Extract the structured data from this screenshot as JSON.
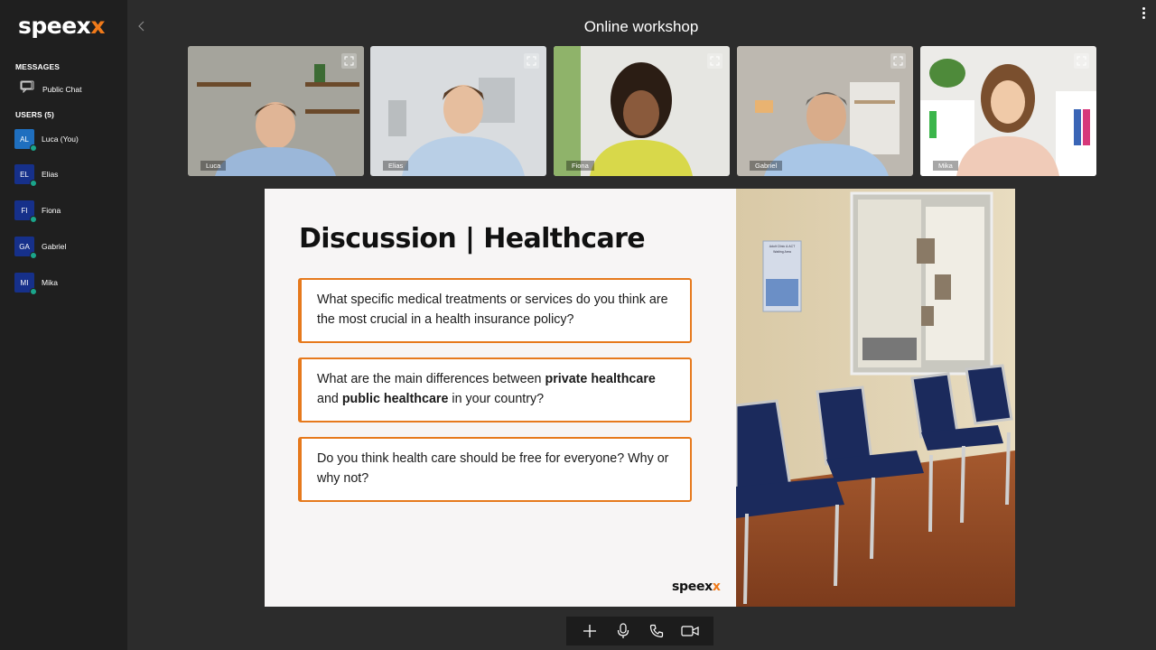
{
  "app": {
    "logo_main": "speex",
    "logo_accent": "x",
    "title": "Online workshop"
  },
  "sidebar": {
    "messages_heading": "MESSAGES",
    "public_chat_label": "Public Chat",
    "users_heading": "USERS (5)",
    "users": [
      {
        "initials": "AL",
        "name": "Luca (You)",
        "color": "#1f6fbf"
      },
      {
        "initials": "EL",
        "name": "Elias",
        "color": "#16308a"
      },
      {
        "initials": "FI",
        "name": "Fiona",
        "color": "#16308a"
      },
      {
        "initials": "GA",
        "name": "Gabriel",
        "color": "#16308a"
      },
      {
        "initials": "MI",
        "name": "Mika",
        "color": "#16308a"
      }
    ],
    "status_color": "#1aa58b"
  },
  "videos": [
    {
      "name": "Luca"
    },
    {
      "name": "Elias"
    },
    {
      "name": "Fiona"
    },
    {
      "name": "Gabriel"
    },
    {
      "name": "Mika"
    }
  ],
  "slide": {
    "title": "Discussion | Healthcare",
    "q1": "What specific medical treatments or services do you think are the most crucial in a health insurance policy?",
    "q2_part1": "What are the main differences between ",
    "q2_bold1": "private healthcare",
    "q2_part2": " and ",
    "q2_bold2": "public healthcare",
    "q2_part3": " in your country?",
    "q3": "Do you think health care should be free for everyone? Why or why not?",
    "logo_main": "speex",
    "logo_accent": "x",
    "accent_color": "#e6791c",
    "poster_line1": "Adult Clinic & ACT",
    "poster_line2": "Waiting Area"
  },
  "toolbar": {
    "icons": [
      "plus-icon",
      "microphone-icon",
      "phone-icon",
      "camera-icon"
    ]
  }
}
